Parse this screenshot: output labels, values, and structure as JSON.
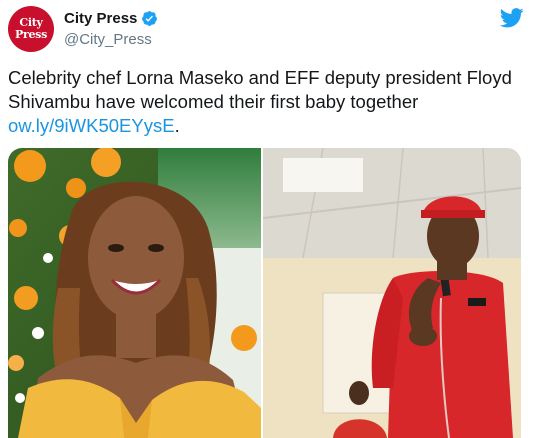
{
  "account": {
    "display_name": "City Press",
    "handle": "@City_Press",
    "avatar_line1": "City",
    "avatar_line2": "Press",
    "verified": true
  },
  "tweet": {
    "text_part1": "Celebrity chef Lorna Maseko and EFF deputy president Floyd Shivambu have welcomed their first baby together ",
    "link_text": "ow.ly/9iWK50EYysE",
    "text_part2": "."
  },
  "colors": {
    "avatar_bg": "#c8102e",
    "verified_blue": "#1da1f2",
    "link_blue": "#1b95e0",
    "handle_gray": "#657786",
    "twitter_bird": "#1da1f2"
  },
  "icons": {
    "verified": "verified-badge-icon",
    "brand": "twitter-bird-icon"
  },
  "media": {
    "images": [
      {
        "name": "photo-woman-yellow-dress"
      },
      {
        "name": "photo-man-red-cap-microphone"
      }
    ]
  }
}
